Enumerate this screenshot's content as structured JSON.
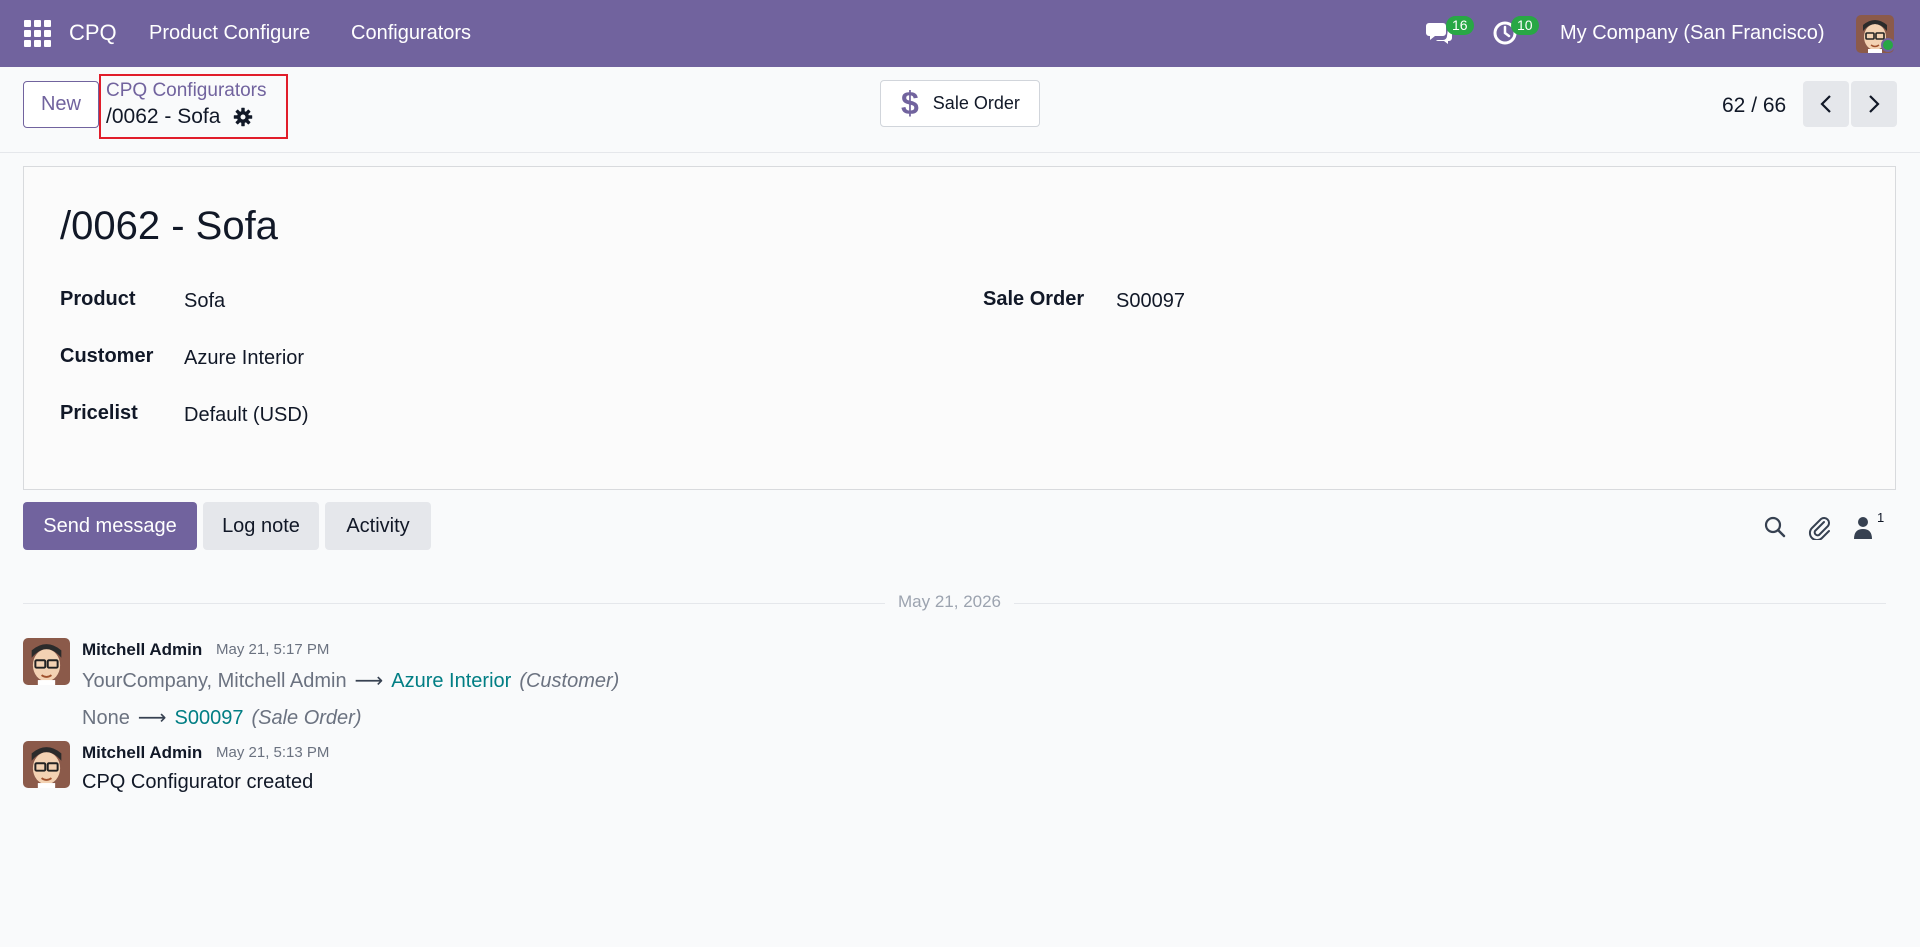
{
  "navbar": {
    "brand": "CPQ",
    "menus": [
      "Product Configure",
      "Configurators"
    ],
    "messages_badge": "16",
    "activities_badge": "10",
    "company": "My Company (San Francisco)"
  },
  "control_panel": {
    "new_label": "New",
    "breadcrumb_parent": "CPQ Configurators",
    "breadcrumb_current": "/0062 - Sofa",
    "smart_button_label": "Sale Order",
    "pager": "62 / 66"
  },
  "form": {
    "title": "/0062 - Sofa",
    "fields_left": [
      {
        "label": "Product",
        "value": "Sofa"
      },
      {
        "label": "Customer",
        "value": "Azure Interior"
      },
      {
        "label": "Pricelist",
        "value": "Default (USD)"
      }
    ],
    "fields_right": [
      {
        "label": "Sale Order",
        "value": "S00097"
      }
    ]
  },
  "chatter": {
    "send_message": "Send message",
    "log_note": "Log note",
    "activity": "Activity",
    "followers_count": "1",
    "date_separator": "May 21, 2026",
    "messages": [
      {
        "author": "Mitchell Admin",
        "date": "May 21, 5:17 PM",
        "changes": [
          {
            "old": "YourCompany, Mitchell Admin",
            "new": "Azure Interior",
            "field": "(Customer)"
          },
          {
            "old": "None",
            "new": "S00097",
            "field": "(Sale Order)"
          }
        ]
      },
      {
        "author": "Mitchell Admin",
        "date": "May 21, 5:13 PM",
        "body": "CPQ Configurator created"
      }
    ]
  },
  "colors": {
    "brand": "#71639e",
    "link": "#017e84",
    "badge": "#28a745",
    "highlight": "#e11d2a"
  }
}
